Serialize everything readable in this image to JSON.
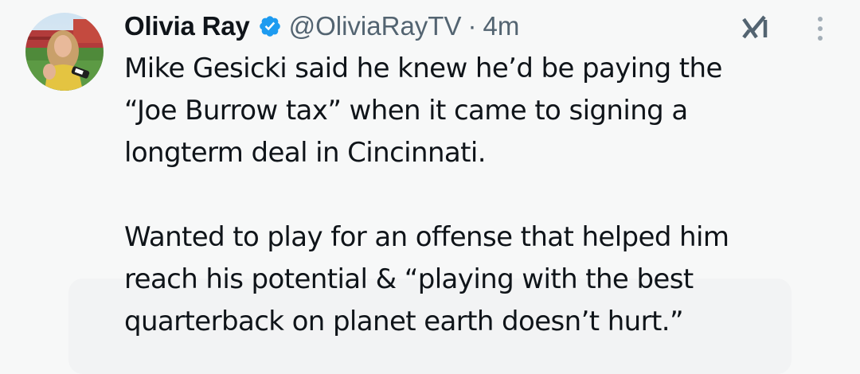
{
  "author": {
    "display_name": "Olivia Ray",
    "handle": "@OliviaRayTV",
    "separator": "·",
    "time": "4m",
    "verified": true
  },
  "icons": {
    "verified": "verified-badge-icon",
    "grok": "grok-icon",
    "more": "more-vertical-icon"
  },
  "colors": {
    "verified_blue": "#1d9bf0",
    "secondary_text": "#536471",
    "primary_text": "#0f1419",
    "background": "#f7f8f8"
  },
  "tweet": {
    "lines_paragraph_1": [
      "Mike Gesicki said he knew he’d be paying the",
      "“Joe Burrow tax” when it came to signing a",
      "longterm deal in Cincinnati."
    ],
    "lines_paragraph_2": [
      "Wanted to play for an offense that helped him",
      "reach his potential & “playing with the best",
      "quarterback on planet earth doesn’t hurt.”"
    ]
  }
}
